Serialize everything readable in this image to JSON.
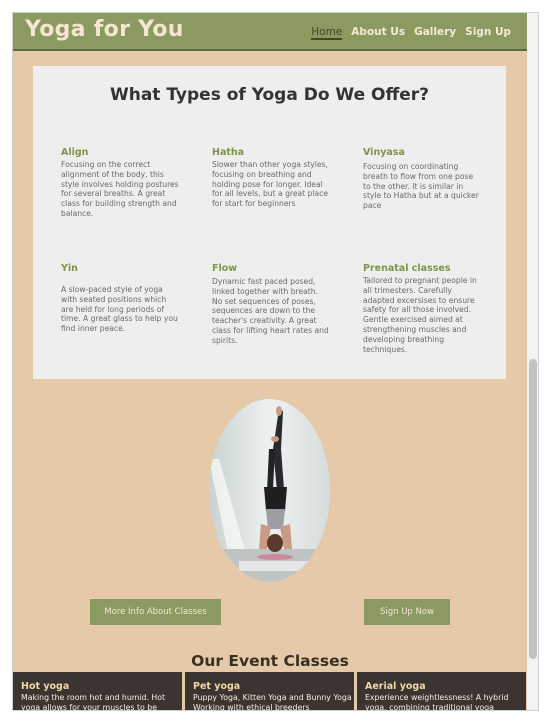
{
  "nav": {
    "brand": "Yoga for You",
    "links": [
      "Home",
      "About Us",
      "Gallery",
      "Sign Up"
    ]
  },
  "offer": {
    "title": "What Types of Yoga Do We Offer?",
    "styles": [
      {
        "name": "Align",
        "desc": "Focusing on the correct alignment of the body, this style involves holding postures for several breaths. A great class for building strength and balance."
      },
      {
        "name": "Hatha",
        "desc": "Slower than other yoga styles, focusing on breathing and holding pose for longer. Ideal for all levels, but a great place for start for beginners"
      },
      {
        "name": "Vinyasa",
        "desc": "Focusing on coordinating breath to flow from one pose to the other. It is similar in style to Hatha but at a quicker pace"
      },
      {
        "name": "Yin",
        "desc": "A slow-paced style of yoga with seated positions which are held for long periods of time. A great glass to help you find inner peace."
      },
      {
        "name": "Flow",
        "desc": "Dynamic fast paced posed, linked together with breath. No set sequences of poses, sequences are down to the teacher's creativity. A great class for lifting heart rates and spirits."
      },
      {
        "name": "Prenatal classes",
        "desc": "Tailored to pregnant people in all trimesters. Carefully adapted excersises to ensure safety for all those involved. Gentle exercised aimed at strengthening muscles and developing breathing techniques."
      }
    ]
  },
  "buttons": {
    "more_info": "More Info About Classes",
    "sign_up": "Sign Up Now"
  },
  "events": {
    "title": "Our Event Classes",
    "cards": [
      {
        "name": "Hot yoga",
        "desc": "Making the room hot and humid. Hot yoga allows for your muscles to be"
      },
      {
        "name": "Pet yoga",
        "desc": "Puppy Yoga, Kitten Yoga and Bunny Yoga Working with ethical breeders"
      },
      {
        "name": "Aerial yoga",
        "desc": "Experience weightlessness! A hybrid yoga, combining traditional yoga"
      }
    ]
  },
  "colors": {
    "nav_bg": "#8a9a60",
    "page_bg": "#e5c9a8",
    "accent_text": "#7e9447"
  }
}
